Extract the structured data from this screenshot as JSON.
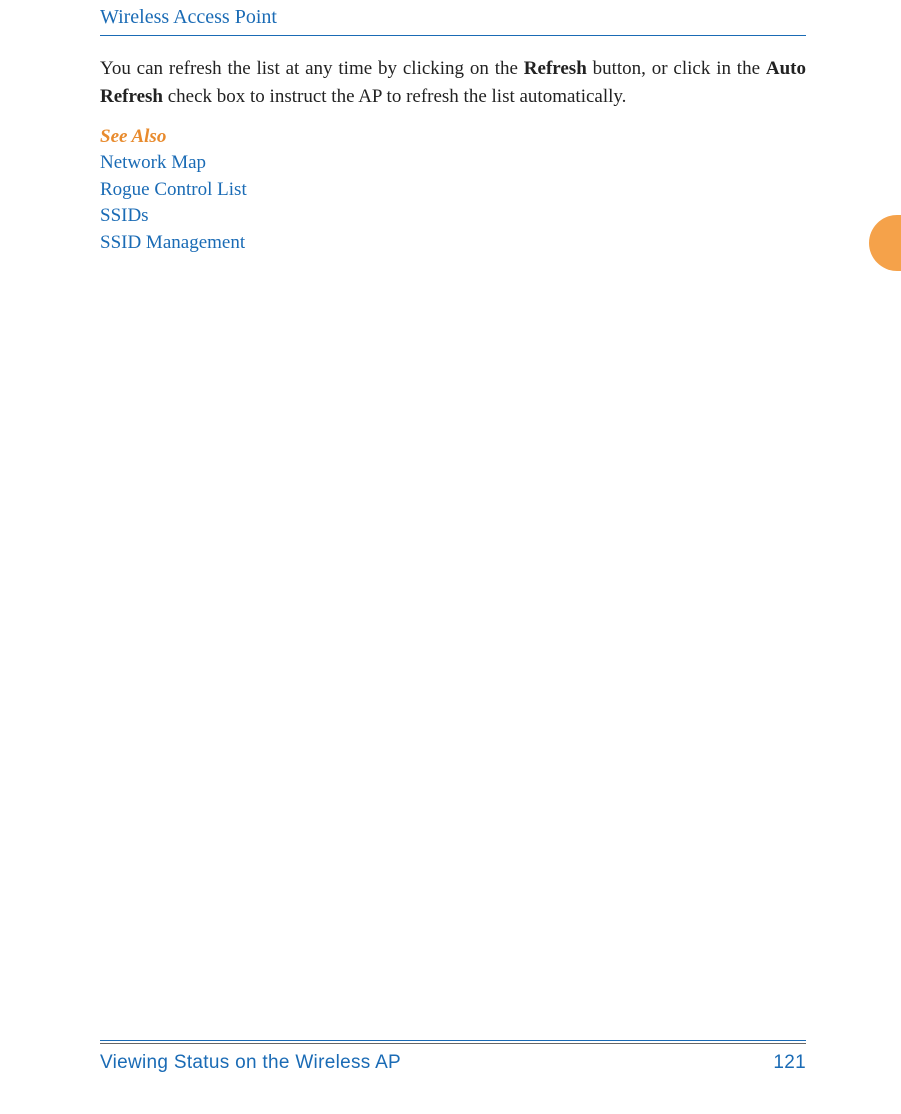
{
  "header": {
    "title": "Wireless Access Point"
  },
  "body": {
    "text_before_bold1": "You can refresh the list at any time by clicking on the ",
    "bold1": "Refresh",
    "text_between": " button, or click in the ",
    "bold2": "Auto Refresh",
    "text_after_bold2": " check box to instruct the AP to refresh the list automatically."
  },
  "see_also": {
    "heading": "See Also",
    "links": [
      "Network Map",
      "Rogue Control List",
      "SSIDs",
      "SSID Management"
    ]
  },
  "footer": {
    "section": "Viewing Status on the Wireless AP",
    "page_number": "121"
  }
}
